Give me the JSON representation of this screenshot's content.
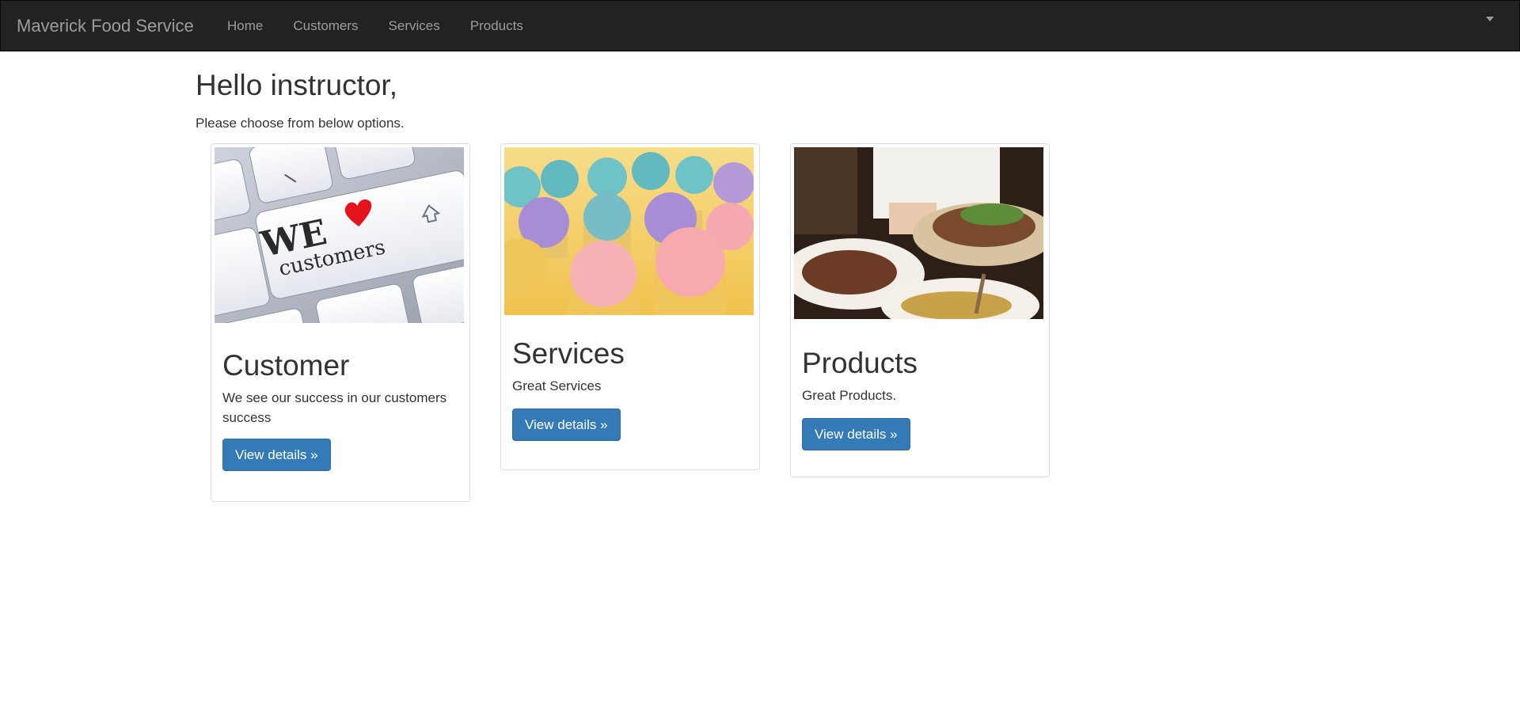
{
  "navbar": {
    "brand": "Maverick Food Service",
    "links": [
      "Home",
      "Customers",
      "Services",
      "Products"
    ]
  },
  "main": {
    "greeting": "Hello instructor,",
    "subtitle": "Please choose from below options."
  },
  "cards": [
    {
      "title": "Customer",
      "text": "We see our success in our customers success",
      "button": "View details »",
      "image_caption": {
        "line1": "WE",
        "line2": "customers"
      }
    },
    {
      "title": "Services",
      "text": "Great Services",
      "button": "View details »"
    },
    {
      "title": "Products",
      "text": "Great Products.",
      "button": "View details »"
    }
  ],
  "colors": {
    "navbar_bg": "#222222",
    "nav_text": "#9d9d9d",
    "primary_button": "#337ab7",
    "heart": "#e3141b"
  },
  "icons": [
    "heart-icon",
    "shift-arrow-icon",
    "caret-down-icon"
  ]
}
